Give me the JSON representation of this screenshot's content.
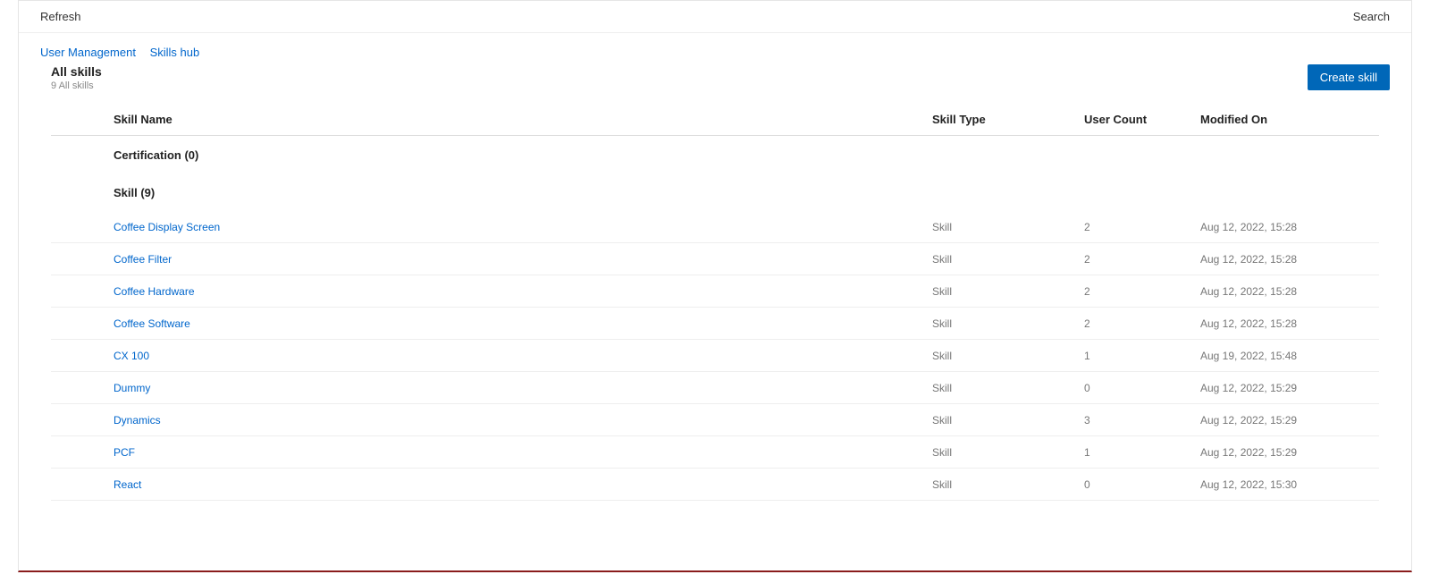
{
  "toolbar": {
    "refresh": "Refresh",
    "search": "Search"
  },
  "breadcrumb": {
    "items": [
      "User Management",
      "Skills hub"
    ]
  },
  "header": {
    "title": "All skills",
    "subtitle": "9 All skills",
    "create_label": "Create skill"
  },
  "columns": {
    "name": "Skill Name",
    "type": "Skill Type",
    "user_count": "User Count",
    "modified": "Modified On"
  },
  "groups": [
    {
      "label": "Certification (0)",
      "rows": []
    },
    {
      "label": "Skill (9)",
      "rows": [
        {
          "name": "Coffee Display Screen",
          "type": "Skill",
          "user_count": "2",
          "modified": "Aug 12, 2022, 15:28"
        },
        {
          "name": "Coffee Filter",
          "type": "Skill",
          "user_count": "2",
          "modified": "Aug 12, 2022, 15:28"
        },
        {
          "name": "Coffee Hardware",
          "type": "Skill",
          "user_count": "2",
          "modified": "Aug 12, 2022, 15:28"
        },
        {
          "name": "Coffee Software",
          "type": "Skill",
          "user_count": "2",
          "modified": "Aug 12, 2022, 15:28"
        },
        {
          "name": "CX 100",
          "type": "Skill",
          "user_count": "1",
          "modified": "Aug 19, 2022, 15:48"
        },
        {
          "name": "Dummy",
          "type": "Skill",
          "user_count": "0",
          "modified": "Aug 12, 2022, 15:29"
        },
        {
          "name": "Dynamics",
          "type": "Skill",
          "user_count": "3",
          "modified": "Aug 12, 2022, 15:29"
        },
        {
          "name": "PCF",
          "type": "Skill",
          "user_count": "1",
          "modified": "Aug 12, 2022, 15:29"
        },
        {
          "name": "React",
          "type": "Skill",
          "user_count": "0",
          "modified": "Aug 12, 2022, 15:30"
        }
      ]
    }
  ]
}
